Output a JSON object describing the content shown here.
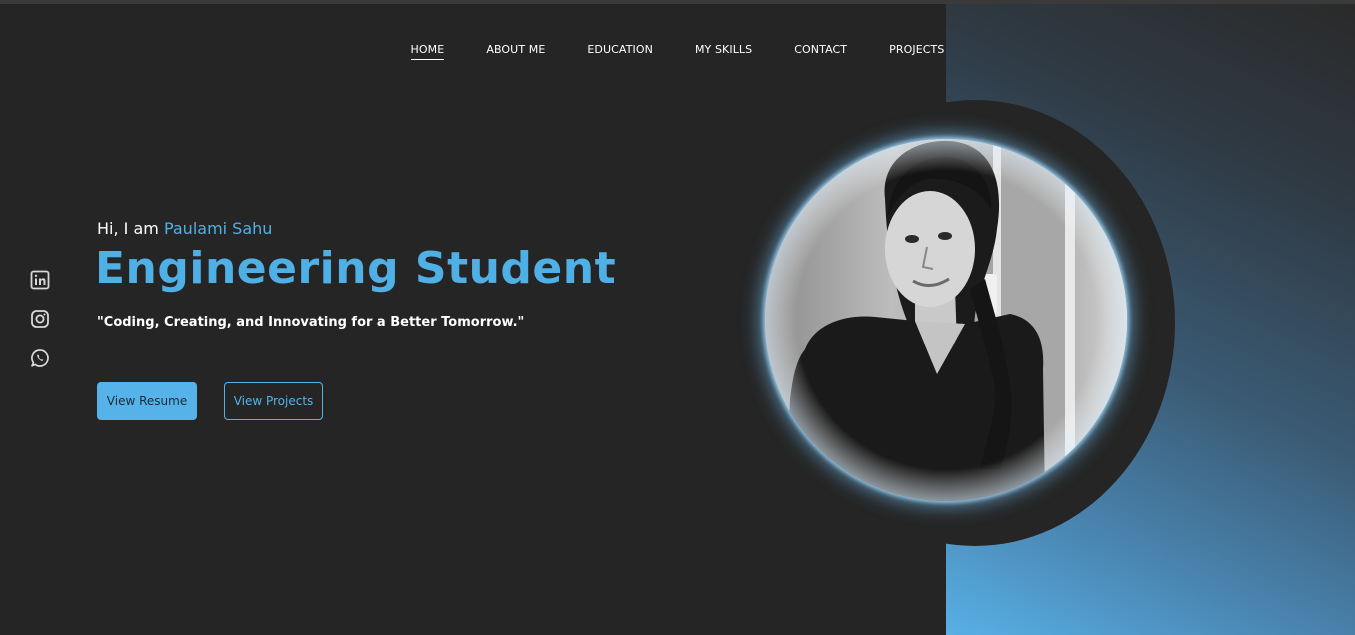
{
  "nav": {
    "items": [
      {
        "label": "HOME",
        "active": true
      },
      {
        "label": "ABOUT ME",
        "active": false
      },
      {
        "label": "EDUCATION",
        "active": false
      },
      {
        "label": "MY SKILLS",
        "active": false
      },
      {
        "label": "CONTACT",
        "active": false
      },
      {
        "label": "PROJECTS",
        "active": false
      }
    ]
  },
  "social": {
    "icons": [
      "linkedin-icon",
      "instagram-icon",
      "whatsapp-icon"
    ]
  },
  "hero": {
    "greeting_prefix": "Hi, I am ",
    "name": "Paulami Sahu",
    "title": "Engineering Student",
    "tagline": "\"Coding, Creating, and Innovating for a Better Tomorrow.\"",
    "resume_button": "View Resume",
    "projects_button": "View Projects"
  },
  "colors": {
    "accent": "#4fb0e6",
    "background": "#252525",
    "text": "#ffffff"
  }
}
